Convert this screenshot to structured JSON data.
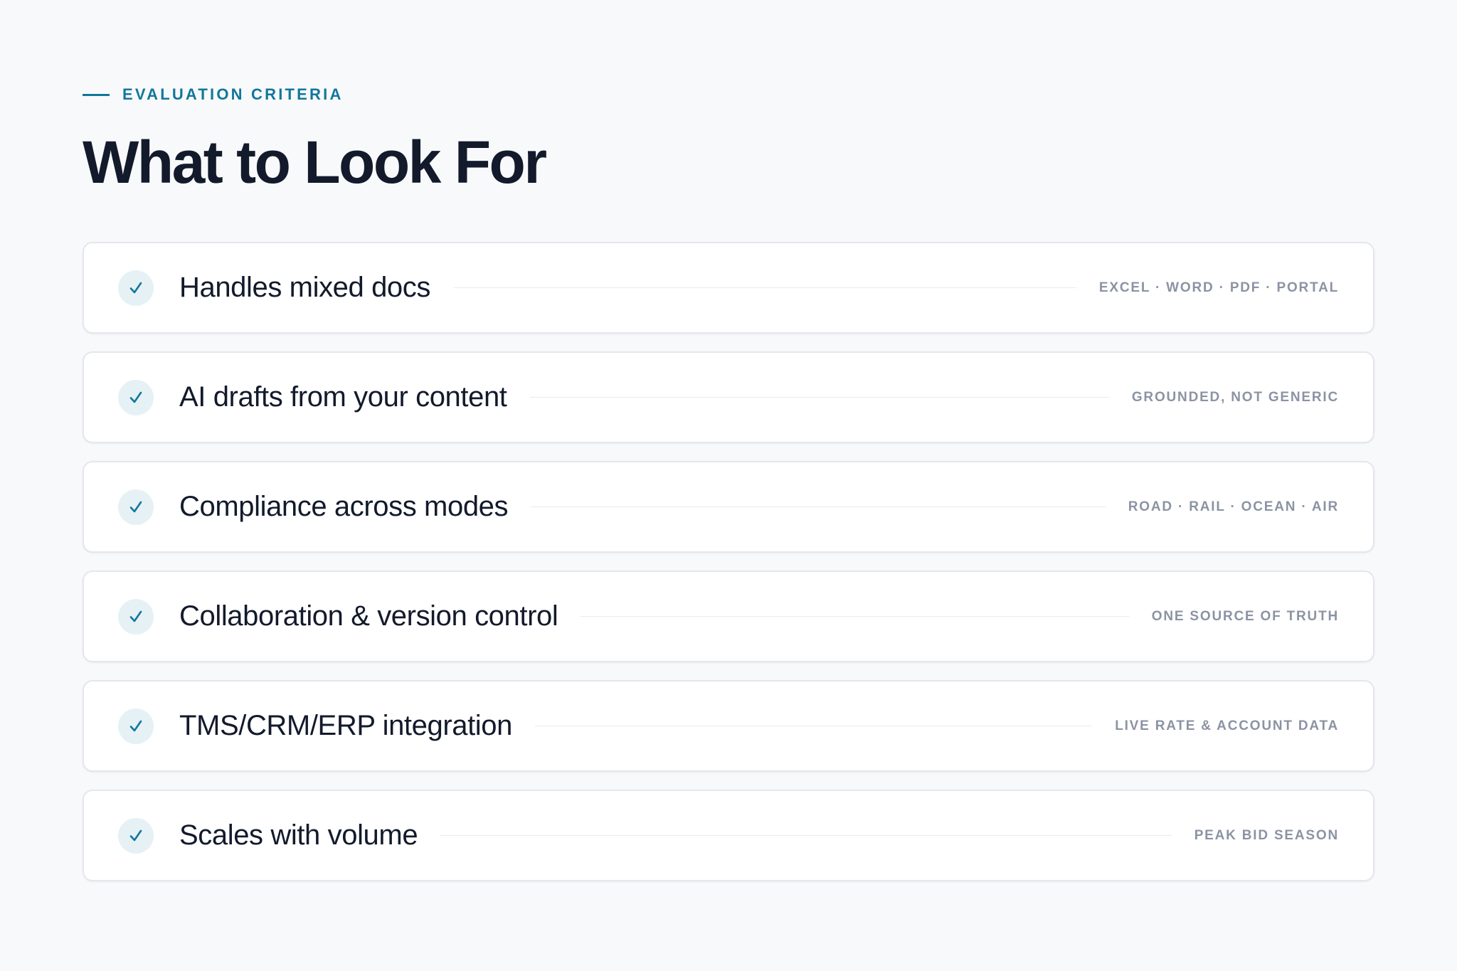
{
  "header": {
    "eyebrow": "EVALUATION CRITERIA",
    "title": "What to Look For"
  },
  "criteria": [
    {
      "title": "Handles mixed docs",
      "tag": "EXCEL · WORD · PDF · PORTAL"
    },
    {
      "title": "AI drafts from your content",
      "tag": "GROUNDED, NOT GENERIC"
    },
    {
      "title": "Compliance across modes",
      "tag": "ROAD · RAIL · OCEAN · AIR"
    },
    {
      "title": "Collaboration & version control",
      "tag": "ONE SOURCE OF TRUTH"
    },
    {
      "title": "TMS/CRM/ERP integration",
      "tag": "LIVE RATE & ACCOUNT DATA"
    },
    {
      "title": "Scales with volume",
      "tag": "PEAK BID SEASON"
    }
  ],
  "colors": {
    "accent": "#11779a",
    "badge_bg": "#e5f1f5",
    "background": "#f8f9fb",
    "text": "#121a2b",
    "muted": "#8b93a3"
  },
  "icons": {
    "check": "check-icon"
  }
}
